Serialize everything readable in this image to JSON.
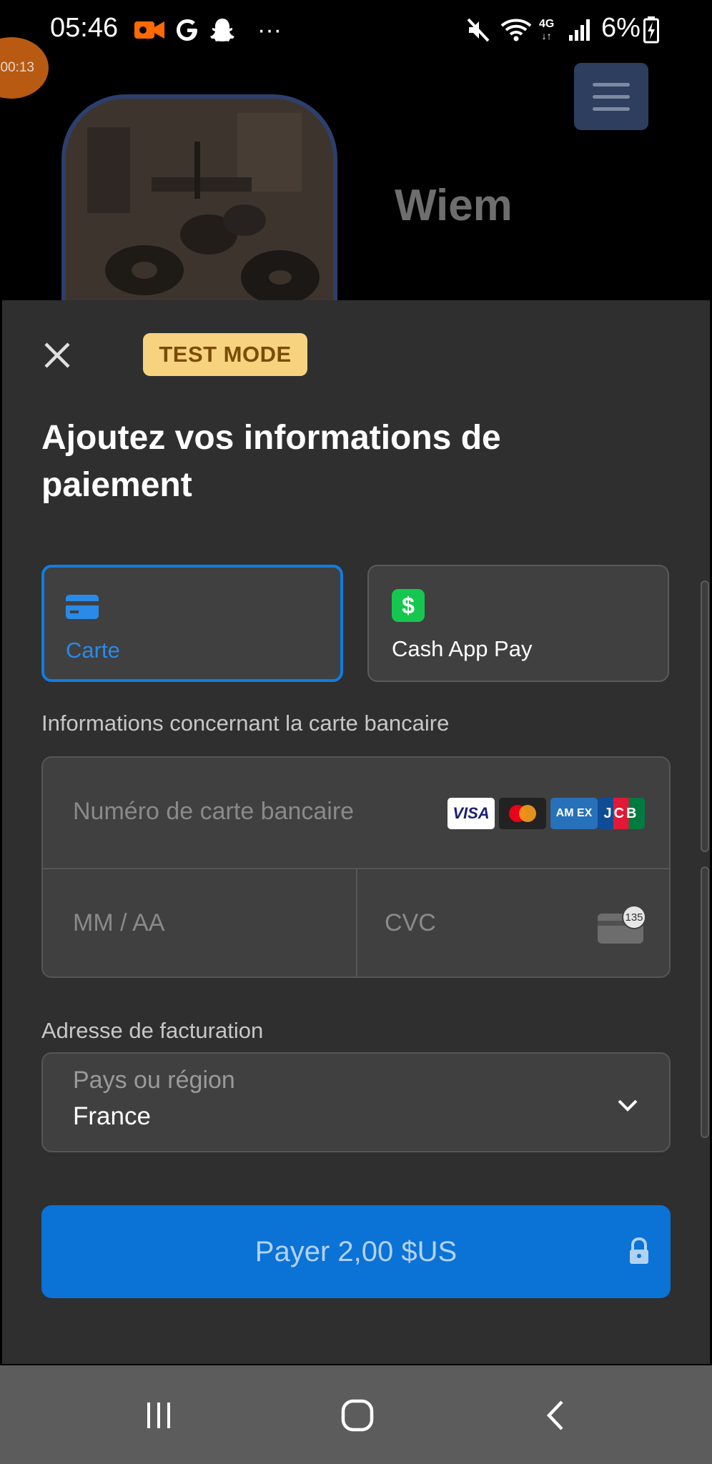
{
  "status_bar": {
    "time": "05:46",
    "battery": "6%",
    "network": "4G",
    "recording_timer": "00:13",
    "left_icons": [
      "video-record-icon",
      "google-icon",
      "snapchat-icon",
      "more-dots-icon"
    ],
    "right_icons": [
      "mute-icon",
      "wifi-icon",
      "network-4g-icon",
      "signal-icon",
      "battery-charging-icon"
    ],
    "colors": {
      "record": "#ff6a00",
      "badge": "#b85a12"
    }
  },
  "background_app": {
    "profile_name": "Wiem",
    "menu_icon": "hamburger-menu-icon"
  },
  "sheet": {
    "test_badge": "TEST MODE",
    "title": "Ajoutez vos informations de paiement",
    "payment_methods": [
      {
        "label": "Carte",
        "icon": "card-icon",
        "selected": true
      },
      {
        "label": "Cash App Pay",
        "icon": "cash-app-icon",
        "glyph": "$",
        "selected": false
      }
    ],
    "card_section_label": "Informations concernant la carte bancaire",
    "card_number_placeholder": "Numéro de carte bancaire",
    "card_brands": [
      "VISA",
      "MC",
      "AM EX",
      "JCB"
    ],
    "expiry_placeholder": "MM / AA",
    "cvc_placeholder": "CVC",
    "cvc_hint_number": "135",
    "billing_label": "Adresse de facturation",
    "country_label": "Pays ou région",
    "country_value": "France",
    "pay_button": "Payer 2,00 $US"
  },
  "colors": {
    "accent": "#0b72d6",
    "sheet_bg": "#2f2f2f",
    "field_bg": "#404040",
    "test_badge_bg": "#f8d37f",
    "cash_app_green": "#16c74f"
  },
  "nav_bar": {
    "items": [
      "recent-apps-icon",
      "home-icon",
      "back-icon"
    ]
  }
}
